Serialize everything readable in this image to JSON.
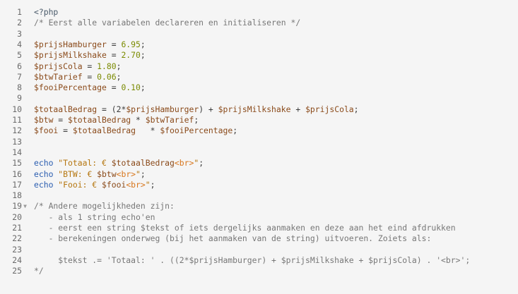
{
  "editor": {
    "lines": [
      {
        "n": "1",
        "fold": "",
        "tokens": [
          [
            "c",
            "<?php"
          ]
        ]
      },
      {
        "n": "2",
        "fold": "",
        "tokens": [
          [
            "cm",
            "/* Eerst alle variabelen declareren en initialiseren */"
          ]
        ]
      },
      {
        "n": "3",
        "fold": "",
        "tokens": []
      },
      {
        "n": "4",
        "fold": "",
        "tokens": [
          [
            "var",
            "$prijsHamburger"
          ],
          [
            "op",
            " = "
          ],
          [
            "num",
            "6.95"
          ],
          [
            "op",
            ";"
          ]
        ]
      },
      {
        "n": "5",
        "fold": "",
        "tokens": [
          [
            "var",
            "$prijsMilkshake"
          ],
          [
            "op",
            " = "
          ],
          [
            "num",
            "2.70"
          ],
          [
            "op",
            ";"
          ]
        ]
      },
      {
        "n": "6",
        "fold": "",
        "tokens": [
          [
            "var",
            "$prijsCola"
          ],
          [
            "op",
            " = "
          ],
          [
            "num",
            "1.80"
          ],
          [
            "op",
            ";"
          ]
        ]
      },
      {
        "n": "7",
        "fold": "",
        "tokens": [
          [
            "var",
            "$btwTarief"
          ],
          [
            "op",
            " = "
          ],
          [
            "num",
            "0.06"
          ],
          [
            "op",
            ";"
          ]
        ]
      },
      {
        "n": "8",
        "fold": "",
        "tokens": [
          [
            "var",
            "$fooiPercentage"
          ],
          [
            "op",
            " = "
          ],
          [
            "num",
            "0.10"
          ],
          [
            "op",
            ";"
          ]
        ]
      },
      {
        "n": "9",
        "fold": "",
        "tokens": []
      },
      {
        "n": "10",
        "fold": "",
        "tokens": [
          [
            "var",
            "$totaalBedrag"
          ],
          [
            "op",
            " = (2*"
          ],
          [
            "var",
            "$prijsHamburger"
          ],
          [
            "op",
            ") + "
          ],
          [
            "var",
            "$prijsMilkshake"
          ],
          [
            "op",
            " + "
          ],
          [
            "var",
            "$prijsCola"
          ],
          [
            "op",
            ";"
          ]
        ]
      },
      {
        "n": "11",
        "fold": "",
        "tokens": [
          [
            "var",
            "$btw"
          ],
          [
            "op",
            " = "
          ],
          [
            "var",
            "$totaalBedrag"
          ],
          [
            "op",
            " * "
          ],
          [
            "var",
            "$btwTarief"
          ],
          [
            "op",
            ";"
          ]
        ]
      },
      {
        "n": "12",
        "fold": "",
        "tokens": [
          [
            "var",
            "$fooi"
          ],
          [
            "op",
            " = "
          ],
          [
            "var",
            "$totaalBedrag"
          ],
          [
            "op",
            "   * "
          ],
          [
            "var",
            "$fooiPercentage"
          ],
          [
            "op",
            ";"
          ]
        ]
      },
      {
        "n": "13",
        "fold": "",
        "tokens": []
      },
      {
        "n": "14",
        "fold": "",
        "tokens": []
      },
      {
        "n": "15",
        "fold": "",
        "tokens": [
          [
            "kw",
            "echo"
          ],
          [
            "op",
            " "
          ],
          [
            "str",
            "\"Totaal: € "
          ],
          [
            "var",
            "$totaalBedrag"
          ],
          [
            "tag",
            "<br>"
          ],
          [
            "str",
            "\""
          ],
          [
            "op",
            ";"
          ]
        ]
      },
      {
        "n": "16",
        "fold": "",
        "tokens": [
          [
            "kw",
            "echo"
          ],
          [
            "op",
            " "
          ],
          [
            "str",
            "\"BTW: € "
          ],
          [
            "var",
            "$btw"
          ],
          [
            "tag",
            "<br>"
          ],
          [
            "str",
            "\""
          ],
          [
            "op",
            ";"
          ]
        ]
      },
      {
        "n": "17",
        "fold": "",
        "tokens": [
          [
            "kw",
            "echo"
          ],
          [
            "op",
            " "
          ],
          [
            "str",
            "\"Fooi: € "
          ],
          [
            "var",
            "$fooi"
          ],
          [
            "tag",
            "<br>"
          ],
          [
            "str",
            "\""
          ],
          [
            "op",
            ";"
          ]
        ]
      },
      {
        "n": "18",
        "fold": "",
        "tokens": []
      },
      {
        "n": "19",
        "fold": "▼",
        "tokens": [
          [
            "cm",
            "/* Andere mogelijkheden zijn:"
          ]
        ]
      },
      {
        "n": "20",
        "fold": "",
        "tokens": [
          [
            "cm",
            "   - als 1 string echo'en"
          ]
        ]
      },
      {
        "n": "21",
        "fold": "",
        "tokens": [
          [
            "cm",
            "   - eerst een string $tekst of iets dergelijks aanmaken en deze aan het eind afdrukken"
          ]
        ]
      },
      {
        "n": "22",
        "fold": "",
        "tokens": [
          [
            "cm",
            "   - berekeningen onderweg (bij het aanmaken van de string) uitvoeren. Zoiets als:"
          ]
        ]
      },
      {
        "n": "23",
        "fold": "",
        "tokens": []
      },
      {
        "n": "24",
        "fold": "",
        "tokens": [
          [
            "cm",
            "     $tekst .= 'Totaal: ' . ((2*$prijsHamburger) + $prijsMilkshake + $prijsCola) . '<br>';"
          ]
        ]
      },
      {
        "n": "25",
        "fold": "",
        "tokens": [
          [
            "cm",
            "*/"
          ]
        ]
      }
    ]
  }
}
